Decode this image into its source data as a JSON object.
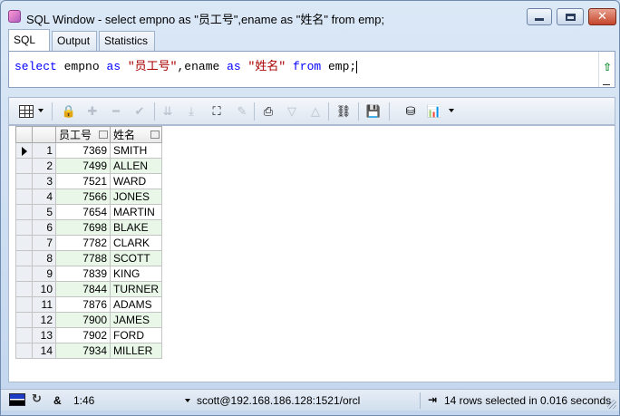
{
  "window": {
    "title": "SQL Window - select empno as \"员工号\",ename as \"姓名\" from emp;"
  },
  "tabs": [
    {
      "label": "SQL",
      "active": true
    },
    {
      "label": "Output",
      "active": false
    },
    {
      "label": "Statistics",
      "active": false
    }
  ],
  "editor": {
    "kw_select": "select",
    "id_empno": "empno",
    "kw_as1": "as",
    "str_col1": "\"员工号\"",
    "sep_comma": ",",
    "id_ename": "ename",
    "kw_as2": "as",
    "str_col2": "\"姓名\"",
    "kw_from": "from",
    "id_emp": "emp",
    "semicolon": ";"
  },
  "toolbar": {
    "icons": [
      "grid-icon",
      "lock-icon",
      "plus-icon",
      "minus-icon",
      "check-icon",
      "down-arrows-icon",
      "down-arrows-bar-icon",
      "binoculars-icon",
      "eraser-icon",
      "print-icon",
      "filter-icon",
      "triangle-up-icon",
      "link-icon",
      "save-icon",
      "database-export-icon",
      "chart-icon"
    ]
  },
  "grid": {
    "columns": [
      "员工号",
      "姓名"
    ],
    "rows": [
      {
        "n": "1",
        "empno": "7369",
        "ename": "SMITH"
      },
      {
        "n": "2",
        "empno": "7499",
        "ename": "ALLEN"
      },
      {
        "n": "3",
        "empno": "7521",
        "ename": "WARD"
      },
      {
        "n": "4",
        "empno": "7566",
        "ename": "JONES"
      },
      {
        "n": "5",
        "empno": "7654",
        "ename": "MARTIN"
      },
      {
        "n": "6",
        "empno": "7698",
        "ename": "BLAKE"
      },
      {
        "n": "7",
        "empno": "7782",
        "ename": "CLARK"
      },
      {
        "n": "8",
        "empno": "7788",
        "ename": "SCOTT"
      },
      {
        "n": "9",
        "empno": "7839",
        "ename": "KING"
      },
      {
        "n": "10",
        "empno": "7844",
        "ename": "TURNER"
      },
      {
        "n": "11",
        "empno": "7876",
        "ename": "ADAMS"
      },
      {
        "n": "12",
        "empno": "7900",
        "ename": "JAMES"
      },
      {
        "n": "13",
        "empno": "7902",
        "ename": "FORD"
      },
      {
        "n": "14",
        "empno": "7934",
        "ename": "MILLER"
      }
    ]
  },
  "status": {
    "amp": "&",
    "position": "1:46",
    "connection": "scott@192.168.186.128:1521/orcl",
    "rows_text": "14 rows selected in 0.016 seconds"
  },
  "colors": {
    "row_stripe": "#e8f7e8",
    "keyword": "#0000ff",
    "string": "#aa0000"
  }
}
